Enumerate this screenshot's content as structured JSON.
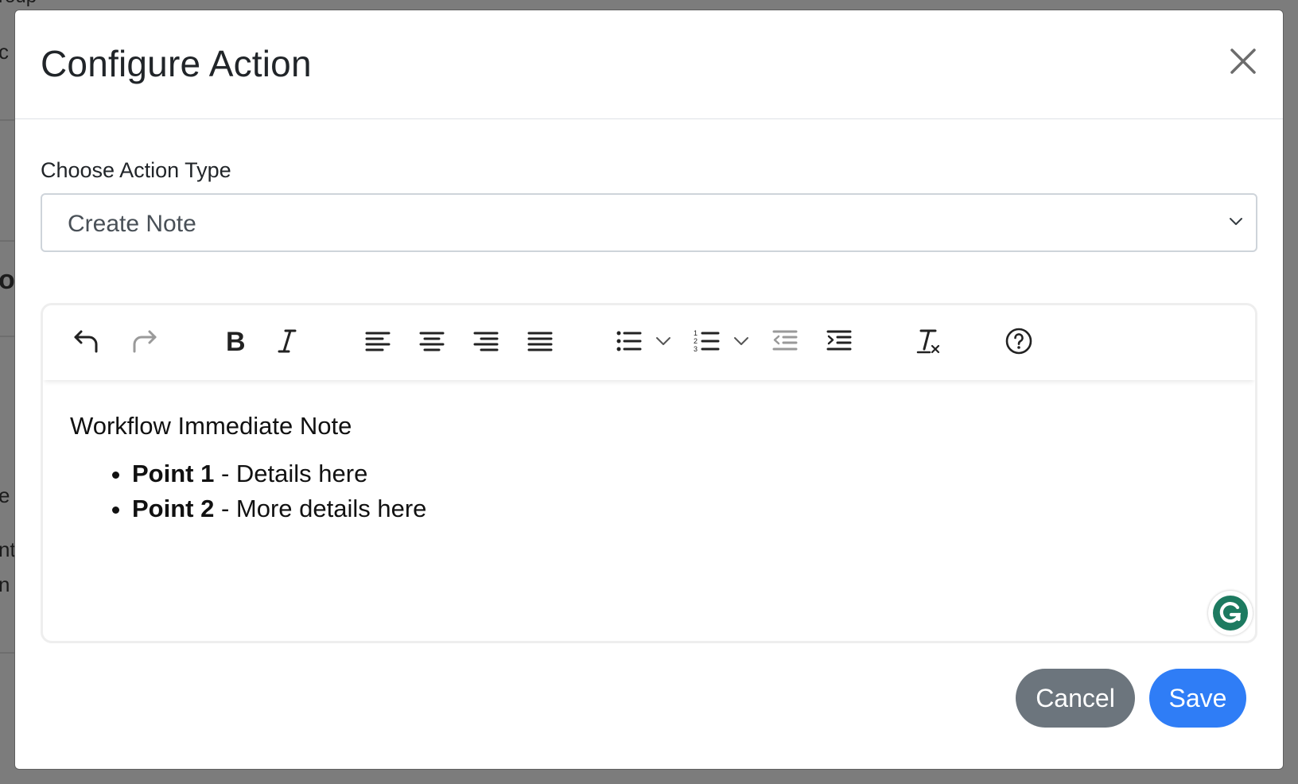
{
  "background": {
    "fragments": [
      "roup",
      "c",
      "o",
      "e N",
      "nt",
      "n l"
    ]
  },
  "modal": {
    "title": "Configure Action",
    "close_label": "×"
  },
  "form": {
    "action_type_label": "Choose Action Type",
    "action_type_value": "Create Note"
  },
  "editor": {
    "toolbar": [
      "undo-icon",
      "redo-icon",
      "bold-icon",
      "italic-icon",
      "align-left-icon",
      "align-center-icon",
      "align-right-icon",
      "align-justify-icon",
      "bullet-list-icon",
      "numbered-list-icon",
      "outdent-icon",
      "indent-icon",
      "clear-formatting-icon",
      "help-icon"
    ],
    "paragraph": "Workflow Immediate Note",
    "list": [
      {
        "bold": "Point 1",
        "rest": " - Details here"
      },
      {
        "bold": "Point 2",
        "rest": " - More details here"
      }
    ]
  },
  "footer": {
    "cancel_label": "Cancel",
    "save_label": "Save"
  },
  "colors": {
    "primary": "#2f7df6",
    "secondary": "#6c757d",
    "grammarly": "#15c39a"
  }
}
